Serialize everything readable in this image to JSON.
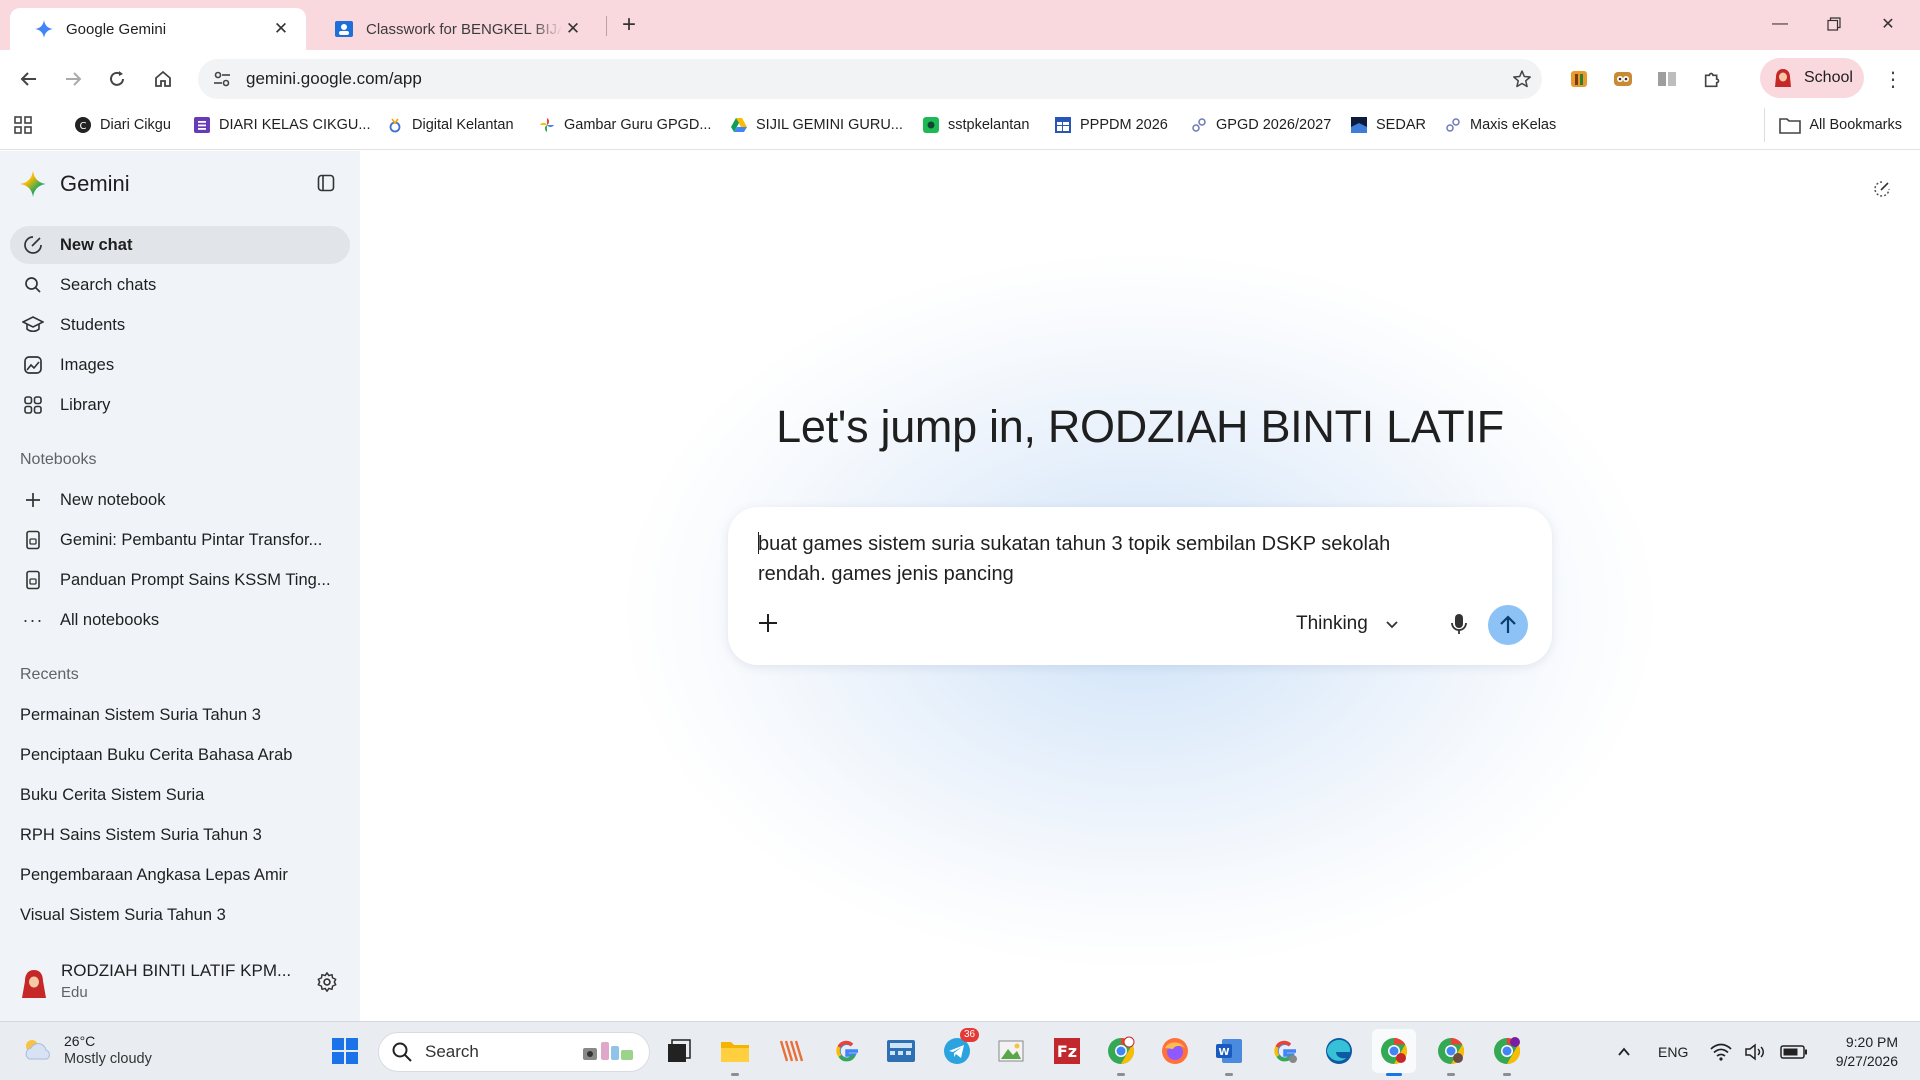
{
  "browser": {
    "tabs": [
      {
        "title": "Google Gemini",
        "active": true
      },
      {
        "title": "Classwork for BENGKEL BIJAK DIGITAL",
        "active": false
      }
    ],
    "url": "gemini.google.com/app",
    "profile_label": "School",
    "bookmarks": [
      "Diari Cikgu",
      "DIARI KELAS CIKGU...",
      "Digital Kelantan",
      "Gambar Guru GPGD...",
      "SIJIL GEMINI GURU...",
      "sstpkelantan",
      "PPPDM 2026",
      "GPGD 2026/2027",
      "SEDAR",
      "Maxis eKelas"
    ],
    "all_bookmarks_label": "All Bookmarks"
  },
  "sidebar": {
    "brand": "Gemini",
    "nav": [
      {
        "label": "New chat",
        "icon": "new-chat-icon",
        "active": true
      },
      {
        "label": "Search chats",
        "icon": "search-icon",
        "active": false
      },
      {
        "label": "Students",
        "icon": "graduation-cap-icon",
        "active": false
      },
      {
        "label": "Images",
        "icon": "image-icon",
        "active": false
      },
      {
        "label": "Library",
        "icon": "library-icon",
        "active": false
      }
    ],
    "notebooks_title": "Notebooks",
    "notebooks": [
      {
        "label": "New notebook",
        "icon": "plus-icon"
      },
      {
        "label": "Gemini: Pembantu Pintar Transfor...",
        "icon": "notebook-icon"
      },
      {
        "label": "Panduan Prompt Sains KSSM Ting...",
        "icon": "notebook-icon"
      },
      {
        "label": "All notebooks",
        "icon": "more-icon"
      }
    ],
    "recents_title": "Recents",
    "recents": [
      "Permainan Sistem Suria Tahun 3",
      "Penciptaan Buku Cerita Bahasa Arab",
      "Buku Cerita Sistem Suria",
      "RPH Sains Sistem Suria Tahun 3",
      "Pengembaraan Angkasa Lepas Amir",
      "Visual Sistem Suria Tahun 3"
    ],
    "user": {
      "name": "RODZIAH BINTI LATIF KPM...",
      "org": "Edu"
    }
  },
  "main": {
    "greeting": "Let's jump in, RODZIAH BINTI LATIF",
    "prompt_text": "buat games sistem suria sukatan tahun 3 topik sembilan DSKP sekolah rendah. games jenis pancing",
    "mode_label": "Thinking"
  },
  "taskbar": {
    "weather_temp": "26°C",
    "weather_condition": "Mostly cloudy",
    "search_placeholder": "Search",
    "telegram_badge": "36",
    "language": "ENG",
    "time": "9:20 PM",
    "date": "9/27/2026"
  },
  "colors": {
    "tabstrip_bg": "#f9d8de",
    "sidebar_bg": "#f0f4f9",
    "send_button": "#8cc2f6",
    "accent": "#1a73e8"
  }
}
